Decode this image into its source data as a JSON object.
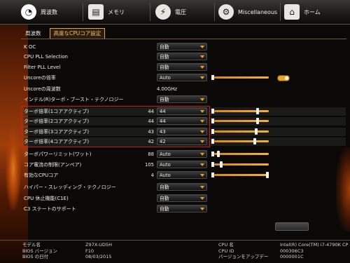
{
  "tabs": [
    {
      "label": "周波数",
      "icon": "speedometer-icon",
      "glyph": "◔"
    },
    {
      "label": "メモリ",
      "icon": "memory-chip-icon",
      "glyph": "▤"
    },
    {
      "label": "電圧",
      "icon": "voltage-icon",
      "glyph": "⚡"
    },
    {
      "label": "Miscellaneous",
      "icon": "gear-icon",
      "glyph": "⚙"
    },
    {
      "label": "ホーム",
      "icon": "home-icon",
      "glyph": "⌂"
    }
  ],
  "subtabs": [
    "周波数",
    "高度なCPUコア設定"
  ],
  "settings": [
    {
      "label": "K OC",
      "current": "",
      "value": "自動",
      "type": "dropdown"
    },
    {
      "label": "CPU PLL Selection",
      "current": "",
      "value": "自動",
      "type": "dropdown"
    },
    {
      "label": "Filter PLL Level",
      "current": "",
      "value": "自動",
      "type": "dropdown"
    },
    {
      "label": "Uncoreの倍率",
      "current": "",
      "value": "Auto",
      "type": "dropdown-slider"
    },
    {
      "label": "Uncoreの周波数",
      "current": "",
      "value": "4.00GHz",
      "type": "text"
    },
    {
      "label": "インテル(R)ターボ・ブースト・テクノロジー",
      "current": "",
      "value": "自動",
      "type": "dropdown"
    },
    {
      "label": "ターボ倍率(1コアアクティブ)",
      "current": "44",
      "value": "44",
      "type": "dropdown-slider"
    },
    {
      "label": "ターボ倍率(2コアアクティブ)",
      "current": "44",
      "value": "44",
      "type": "dropdown-slider"
    },
    {
      "label": "ターボ倍率(3コアアクティブ)",
      "current": "43",
      "value": "43",
      "type": "dropdown-slider"
    },
    {
      "label": "ターボ倍率(4コアアクティブ)",
      "current": "42",
      "value": "42",
      "type": "dropdown-slider"
    },
    {
      "label": "ターボパワーリミット(ワット)",
      "current": "88",
      "value": "Auto",
      "type": "dropdown-slider"
    },
    {
      "label": "コア電流の制限(アンペア)",
      "current": "105",
      "value": "Auto",
      "type": "dropdown-slider"
    },
    {
      "label": "有効なCPUコア",
      "current": "4",
      "value": "Auto",
      "type": "dropdown-slider"
    },
    {
      "label": "ハイパー・スレッディング・テクノロジー",
      "current": "",
      "value": "自動",
      "type": "dropdown"
    },
    {
      "label": "CPU 休止機能(C1E)",
      "current": "",
      "value": "自動",
      "type": "dropdown"
    },
    {
      "label": "C3 ステートのサポート",
      "current": "",
      "value": "自動",
      "type": "dropdown"
    }
  ],
  "footer": {
    "left": [
      {
        "label": "モデル名",
        "value": "Z97X-UD5H"
      },
      {
        "label": "BIOS バージョン",
        "value": "F10"
      },
      {
        "label": "BIOS の日付",
        "value": "08/03/2015"
      }
    ],
    "right": [
      {
        "label": "CPU 名",
        "value": "Intel(R) Core(TM) i7-4790K CP"
      },
      {
        "label": "CPU ID",
        "value": "000306C3"
      },
      {
        "label": "バージョンをアップデー",
        "value": "0000001C"
      }
    ]
  },
  "colors": {
    "accent": "#f0a020",
    "highlight_border": "#d21c1c",
    "active_subtab": "#e8a23c"
  }
}
